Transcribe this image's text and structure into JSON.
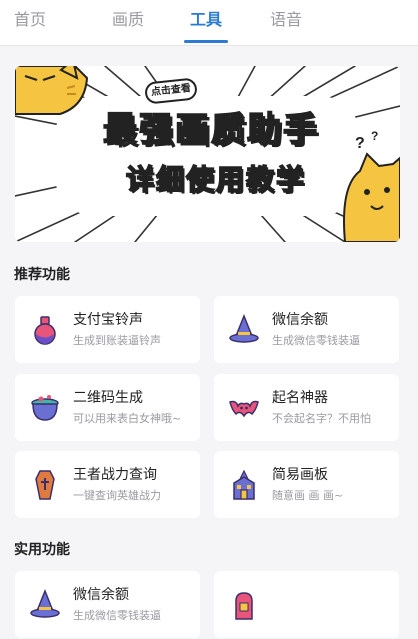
{
  "tabs": [
    {
      "label": "首页"
    },
    {
      "label": "画质"
    },
    {
      "label": "工具"
    },
    {
      "label": "语音"
    }
  ],
  "active_tab": "工具",
  "accent_color": "#2b7bd4",
  "banner": {
    "bubble": "点击查看",
    "title": "最强画质助手",
    "subtitle": "详细使用教学"
  },
  "sections": [
    {
      "title": "推荐功能",
      "items": [
        {
          "name": "支付宝铃声",
          "desc": "生成到账装逼铃声",
          "icon": "potion-bottle-icon"
        },
        {
          "name": "微信余额",
          "desc": "生成微信零钱装逼",
          "icon": "wizard-hat-icon"
        },
        {
          "name": "二维码生成",
          "desc": "可以用来表白女神哦~",
          "icon": "cauldron-icon"
        },
        {
          "name": "起名神器",
          "desc": "不会起名字？不用怕",
          "icon": "bat-icon"
        },
        {
          "name": "王者战力查询",
          "desc": "一键查询英雄战力",
          "icon": "coffin-icon"
        },
        {
          "name": "简易画板",
          "desc": "随意画 画 画~",
          "icon": "haunted-house-icon"
        }
      ]
    },
    {
      "title": "实用功能",
      "items": [
        {
          "name": "微信余额",
          "desc": "生成微信零钱装逼",
          "icon": "wizard-hat-icon"
        },
        {
          "name": "",
          "desc": "",
          "icon": "tombstone-icon"
        }
      ]
    }
  ]
}
